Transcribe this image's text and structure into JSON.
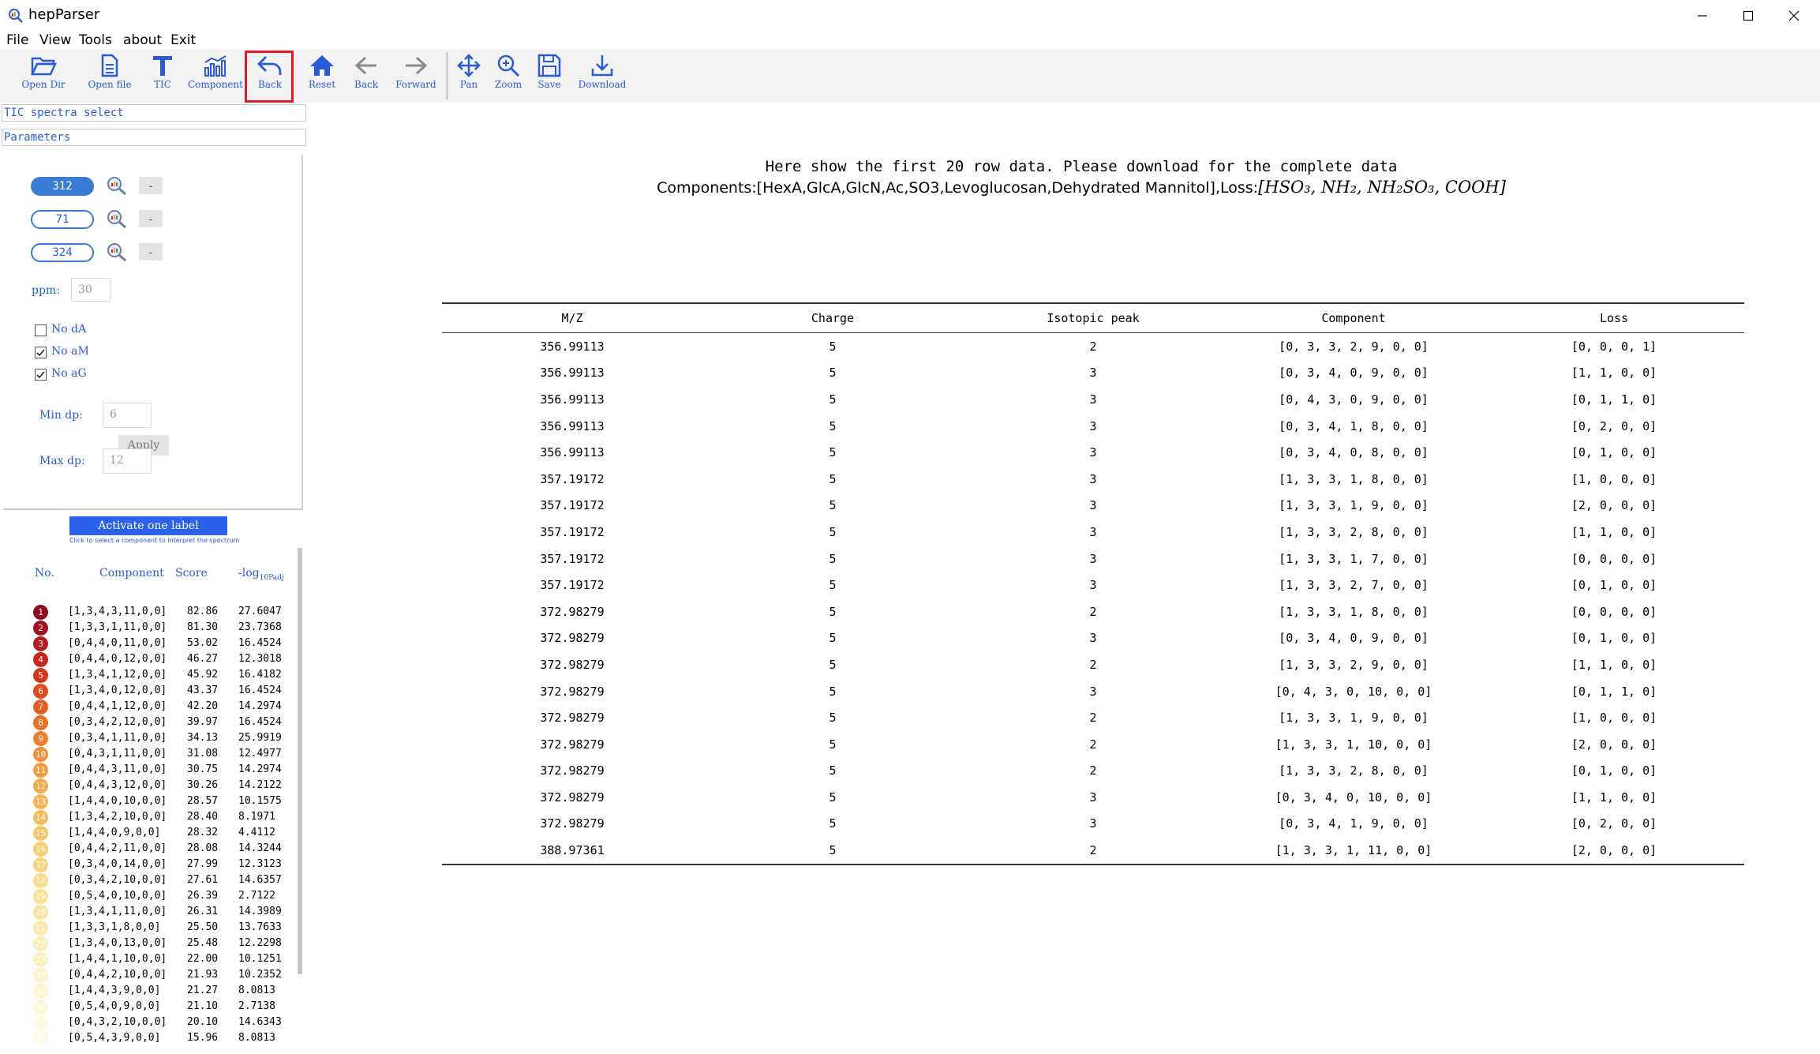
{
  "window": {
    "title": "hepParser"
  },
  "menu": [
    "File",
    "View",
    "Tools",
    "about",
    "Exit"
  ],
  "toolbar": {
    "open_dir": "Open Dir",
    "open_file": "Open file",
    "tic": "TIC",
    "component": "Component",
    "back_main": "Back",
    "reset": "Reset",
    "back": "Back",
    "forward": "Forward",
    "pan": "Pan",
    "zoom": "Zoom",
    "save": "Save",
    "download": "Download"
  },
  "sidebar": {
    "tic_select": "TIC spectra select",
    "parameters": "Parameters",
    "peaks": [
      "312",
      "71",
      "324"
    ],
    "remove_label": "-",
    "ppm_label": "ppm:",
    "ppm_value": "30",
    "apply": "Apply",
    "checks": [
      {
        "label": "No dA",
        "checked": false
      },
      {
        "label": "No aM",
        "checked": true
      },
      {
        "label": "No aG",
        "checked": true
      }
    ],
    "min_dp_label": "Min dp:",
    "min_dp": "6",
    "max_dp_label": "Max dp:",
    "max_dp": "12",
    "activate": "Activate one label",
    "hint": "Click to select a component to interpret the spectrum",
    "rank_headers": {
      "no": "No.",
      "component": "Component",
      "score": "Score",
      "logp": "-log"
    },
    "logp_sub": "10",
    "logp_tail": "Padj",
    "ranks": [
      {
        "no": "1",
        "component": "[1,3,4,3,11,0,0]",
        "score": "82.86",
        "logp": "27.6047"
      },
      {
        "no": "2",
        "component": "[1,3,3,1,11,0,0]",
        "score": "81.30",
        "logp": "23.7368"
      },
      {
        "no": "3",
        "component": "[0,4,4,0,11,0,0]",
        "score": "53.02",
        "logp": "16.4524"
      },
      {
        "no": "4",
        "component": "[0,4,4,0,12,0,0]",
        "score": "46.27",
        "logp": "12.3018"
      },
      {
        "no": "5",
        "component": "[1,3,4,1,12,0,0]",
        "score": "45.92",
        "logp": "16.4182"
      },
      {
        "no": "6",
        "component": "[1,3,4,0,12,0,0]",
        "score": "43.37",
        "logp": "16.4524"
      },
      {
        "no": "7",
        "component": "[0,4,4,1,12,0,0]",
        "score": "42.20",
        "logp": "14.2974"
      },
      {
        "no": "8",
        "component": "[0,3,4,2,12,0,0]",
        "score": "39.97",
        "logp": "16.4524"
      },
      {
        "no": "9",
        "component": "[0,3,4,1,11,0,0]",
        "score": "34.13",
        "logp": "25.9919"
      },
      {
        "no": "10",
        "component": "[0,4,3,1,11,0,0]",
        "score": "31.08",
        "logp": "12.4977"
      },
      {
        "no": "11",
        "component": "[0,4,4,3,11,0,0]",
        "score": "30.75",
        "logp": "14.2974"
      },
      {
        "no": "12",
        "component": "[0,4,4,3,12,0,0]",
        "score": "30.26",
        "logp": "14.2122"
      },
      {
        "no": "13",
        "component": "[1,4,4,0,10,0,0]",
        "score": "28.57",
        "logp": "10.1575"
      },
      {
        "no": "14",
        "component": "[1,3,4,2,10,0,0]",
        "score": "28.40",
        "logp": "8.1971"
      },
      {
        "no": "15",
        "component": "[1,4,4,0,9,0,0]",
        "score": "28.32",
        "logp": "4.4112"
      },
      {
        "no": "16",
        "component": "[0,4,4,2,11,0,0]",
        "score": "28.08",
        "logp": "14.3244"
      },
      {
        "no": "17",
        "component": "[0,3,4,0,14,0,0]",
        "score": "27.99",
        "logp": "12.3123"
      },
      {
        "no": "18",
        "component": "[0,3,4,2,10,0,0]",
        "score": "27.61",
        "logp": "14.6357"
      },
      {
        "no": "19",
        "component": "[0,5,4,0,10,0,0]",
        "score": "26.39",
        "logp": "2.7122"
      },
      {
        "no": "20",
        "component": "[1,3,4,1,11,0,0]",
        "score": "26.31",
        "logp": "14.3989"
      },
      {
        "no": "21",
        "component": "[1,3,3,1,8,0,0]",
        "score": "25.50",
        "logp": "13.7633"
      },
      {
        "no": "22",
        "component": "[1,3,4,0,13,0,0]",
        "score": "25.48",
        "logp": "12.2298"
      },
      {
        "no": "23",
        "component": "[1,4,4,1,10,0,0]",
        "score": "22.00",
        "logp": "10.1251"
      },
      {
        "no": "24",
        "component": "[0,4,4,2,10,0,0]",
        "score": "21.93",
        "logp": "10.2352"
      },
      {
        "no": "25",
        "component": "[1,4,4,3,9,0,0]",
        "score": "21.27",
        "logp": "8.0813"
      },
      {
        "no": "26",
        "component": "[0,5,4,0,9,0,0]",
        "score": "21.10",
        "logp": "2.7138"
      },
      {
        "no": "27",
        "component": "[0,4,3,2,10,0,0]",
        "score": "20.10",
        "logp": "14.6343"
      },
      {
        "no": "28",
        "component": "[0,5,4,3,9,0,0]",
        "score": "15.96",
        "logp": "8.0813"
      }
    ]
  },
  "main": {
    "caption_line1": "Here show the first 20 row data. Please download for the complete data",
    "caption_components": "Components:[HexA,GlcA,GlcN,Ac,SO3,Levoglucosan,Dehydrated Mannitol],Loss:",
    "caption_loss": "[HSO₃,  NH₂,  NH₂SO₃,  COOH]",
    "columns": [
      "M/Z",
      "Charge",
      "Isotopic peak",
      "Component",
      "Loss"
    ],
    "rows": [
      [
        "356.99113",
        "5",
        "2",
        "[0, 3, 3, 2, 9, 0, 0]",
        "[0, 0, 0, 1]"
      ],
      [
        "356.99113",
        "5",
        "3",
        "[0, 3, 4, 0, 9, 0, 0]",
        "[1, 1, 0, 0]"
      ],
      [
        "356.99113",
        "5",
        "3",
        "[0, 4, 3, 0, 9, 0, 0]",
        "[0, 1, 1, 0]"
      ],
      [
        "356.99113",
        "5",
        "3",
        "[0, 3, 4, 1, 8, 0, 0]",
        "[0, 2, 0, 0]"
      ],
      [
        "356.99113",
        "5",
        "3",
        "[0, 3, 4, 0, 8, 0, 0]",
        "[0, 1, 0, 0]"
      ],
      [
        "357.19172",
        "5",
        "3",
        "[1, 3, 3, 1, 8, 0, 0]",
        "[1, 0, 0, 0]"
      ],
      [
        "357.19172",
        "5",
        "3",
        "[1, 3, 3, 1, 9, 0, 0]",
        "[2, 0, 0, 0]"
      ],
      [
        "357.19172",
        "5",
        "3",
        "[1, 3, 3, 2, 8, 0, 0]",
        "[1, 1, 0, 0]"
      ],
      [
        "357.19172",
        "5",
        "3",
        "[1, 3, 3, 1, 7, 0, 0]",
        "[0, 0, 0, 0]"
      ],
      [
        "357.19172",
        "5",
        "3",
        "[1, 3, 3, 2, 7, 0, 0]",
        "[0, 1, 0, 0]"
      ],
      [
        "372.98279",
        "5",
        "2",
        "[1, 3, 3, 1, 8, 0, 0]",
        "[0, 0, 0, 0]"
      ],
      [
        "372.98279",
        "5",
        "3",
        "[0, 3, 4, 0, 9, 0, 0]",
        "[0, 1, 0, 0]"
      ],
      [
        "372.98279",
        "5",
        "2",
        "[1, 3, 3, 2, 9, 0, 0]",
        "[1, 1, 0, 0]"
      ],
      [
        "372.98279",
        "5",
        "3",
        "[0, 4, 3, 0, 10, 0, 0]",
        "[0, 1, 1, 0]"
      ],
      [
        "372.98279",
        "5",
        "2",
        "[1, 3, 3, 1, 9, 0, 0]",
        "[1, 0, 0, 0]"
      ],
      [
        "372.98279",
        "5",
        "2",
        "[1, 3, 3, 1, 10, 0, 0]",
        "[2, 0, 0, 0]"
      ],
      [
        "372.98279",
        "5",
        "2",
        "[1, 3, 3, 2, 8, 0, 0]",
        "[0, 1, 0, 0]"
      ],
      [
        "372.98279",
        "5",
        "3",
        "[0, 3, 4, 0, 10, 0, 0]",
        "[1, 1, 0, 0]"
      ],
      [
        "372.98279",
        "5",
        "3",
        "[0, 3, 4, 1, 9, 0, 0]",
        "[0, 2, 0, 0]"
      ],
      [
        "388.97361",
        "5",
        "2",
        "[1, 3, 3, 1, 11, 0, 0]",
        "[2, 0, 0, 0]"
      ]
    ]
  },
  "colors": {
    "accent": "#2a5bd7",
    "highlight": "#e0192a",
    "toolbar_bg": "#f3f3f3"
  }
}
